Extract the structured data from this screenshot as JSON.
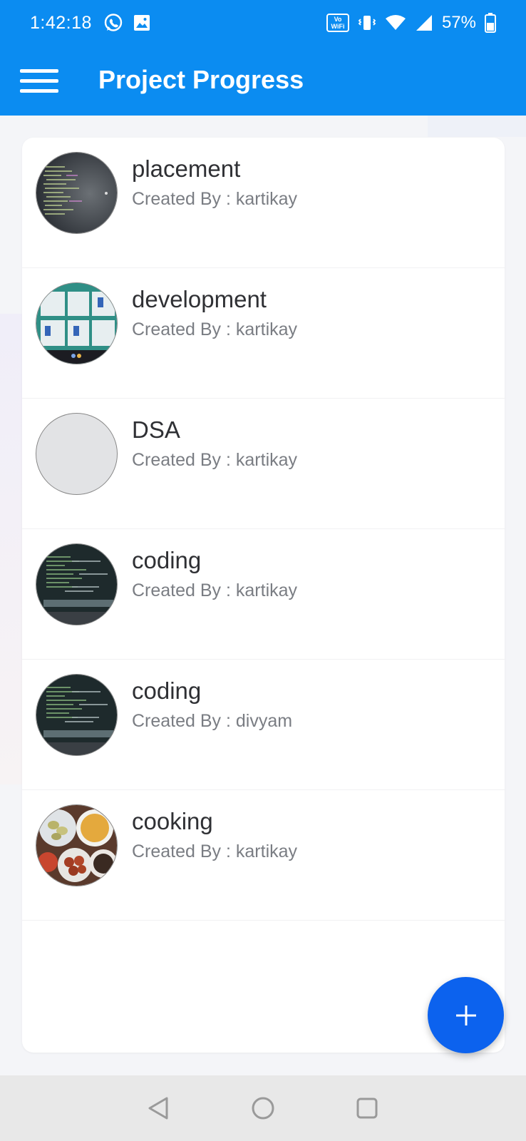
{
  "status_bar": {
    "time": "1:42:18",
    "battery_pct": "57%",
    "left_icons": [
      "whatsapp-icon",
      "gallery-icon"
    ],
    "right_icons": [
      "vowifi-icon",
      "vibrate-icon",
      "wifi-icon",
      "signal-icon",
      "battery-icon"
    ],
    "vowifi_label": "Vo WiFi"
  },
  "app_bar": {
    "title": "Project Progress",
    "menu_icon": "hamburger-menu-icon"
  },
  "projects": [
    {
      "title": "placement",
      "subtitle": "Created By : kartikay",
      "thumbnail": "code-screen-photo"
    },
    {
      "title": "development",
      "subtitle": "Created By : kartikay",
      "thumbnail": "app-screens-photo"
    },
    {
      "title": "DSA",
      "subtitle": "Created By : kartikay",
      "thumbnail": "empty-placeholder"
    },
    {
      "title": "coding",
      "subtitle": "Created By : kartikay",
      "thumbnail": "terminal-photo"
    },
    {
      "title": "coding",
      "subtitle": "Created By : divyam",
      "thumbnail": "terminal-photo"
    },
    {
      "title": "cooking",
      "subtitle": "Created By : kartikay",
      "thumbnail": "food-plates-photo"
    }
  ],
  "fab": {
    "icon": "plus-icon"
  },
  "nav_bar": {
    "buttons": [
      "back-icon",
      "home-icon",
      "recents-icon"
    ]
  },
  "colors": {
    "primary": "#0b8cf1",
    "fab": "#0c62ee",
    "title_text": "#2f3034",
    "subtitle_text": "#7a7d83"
  }
}
